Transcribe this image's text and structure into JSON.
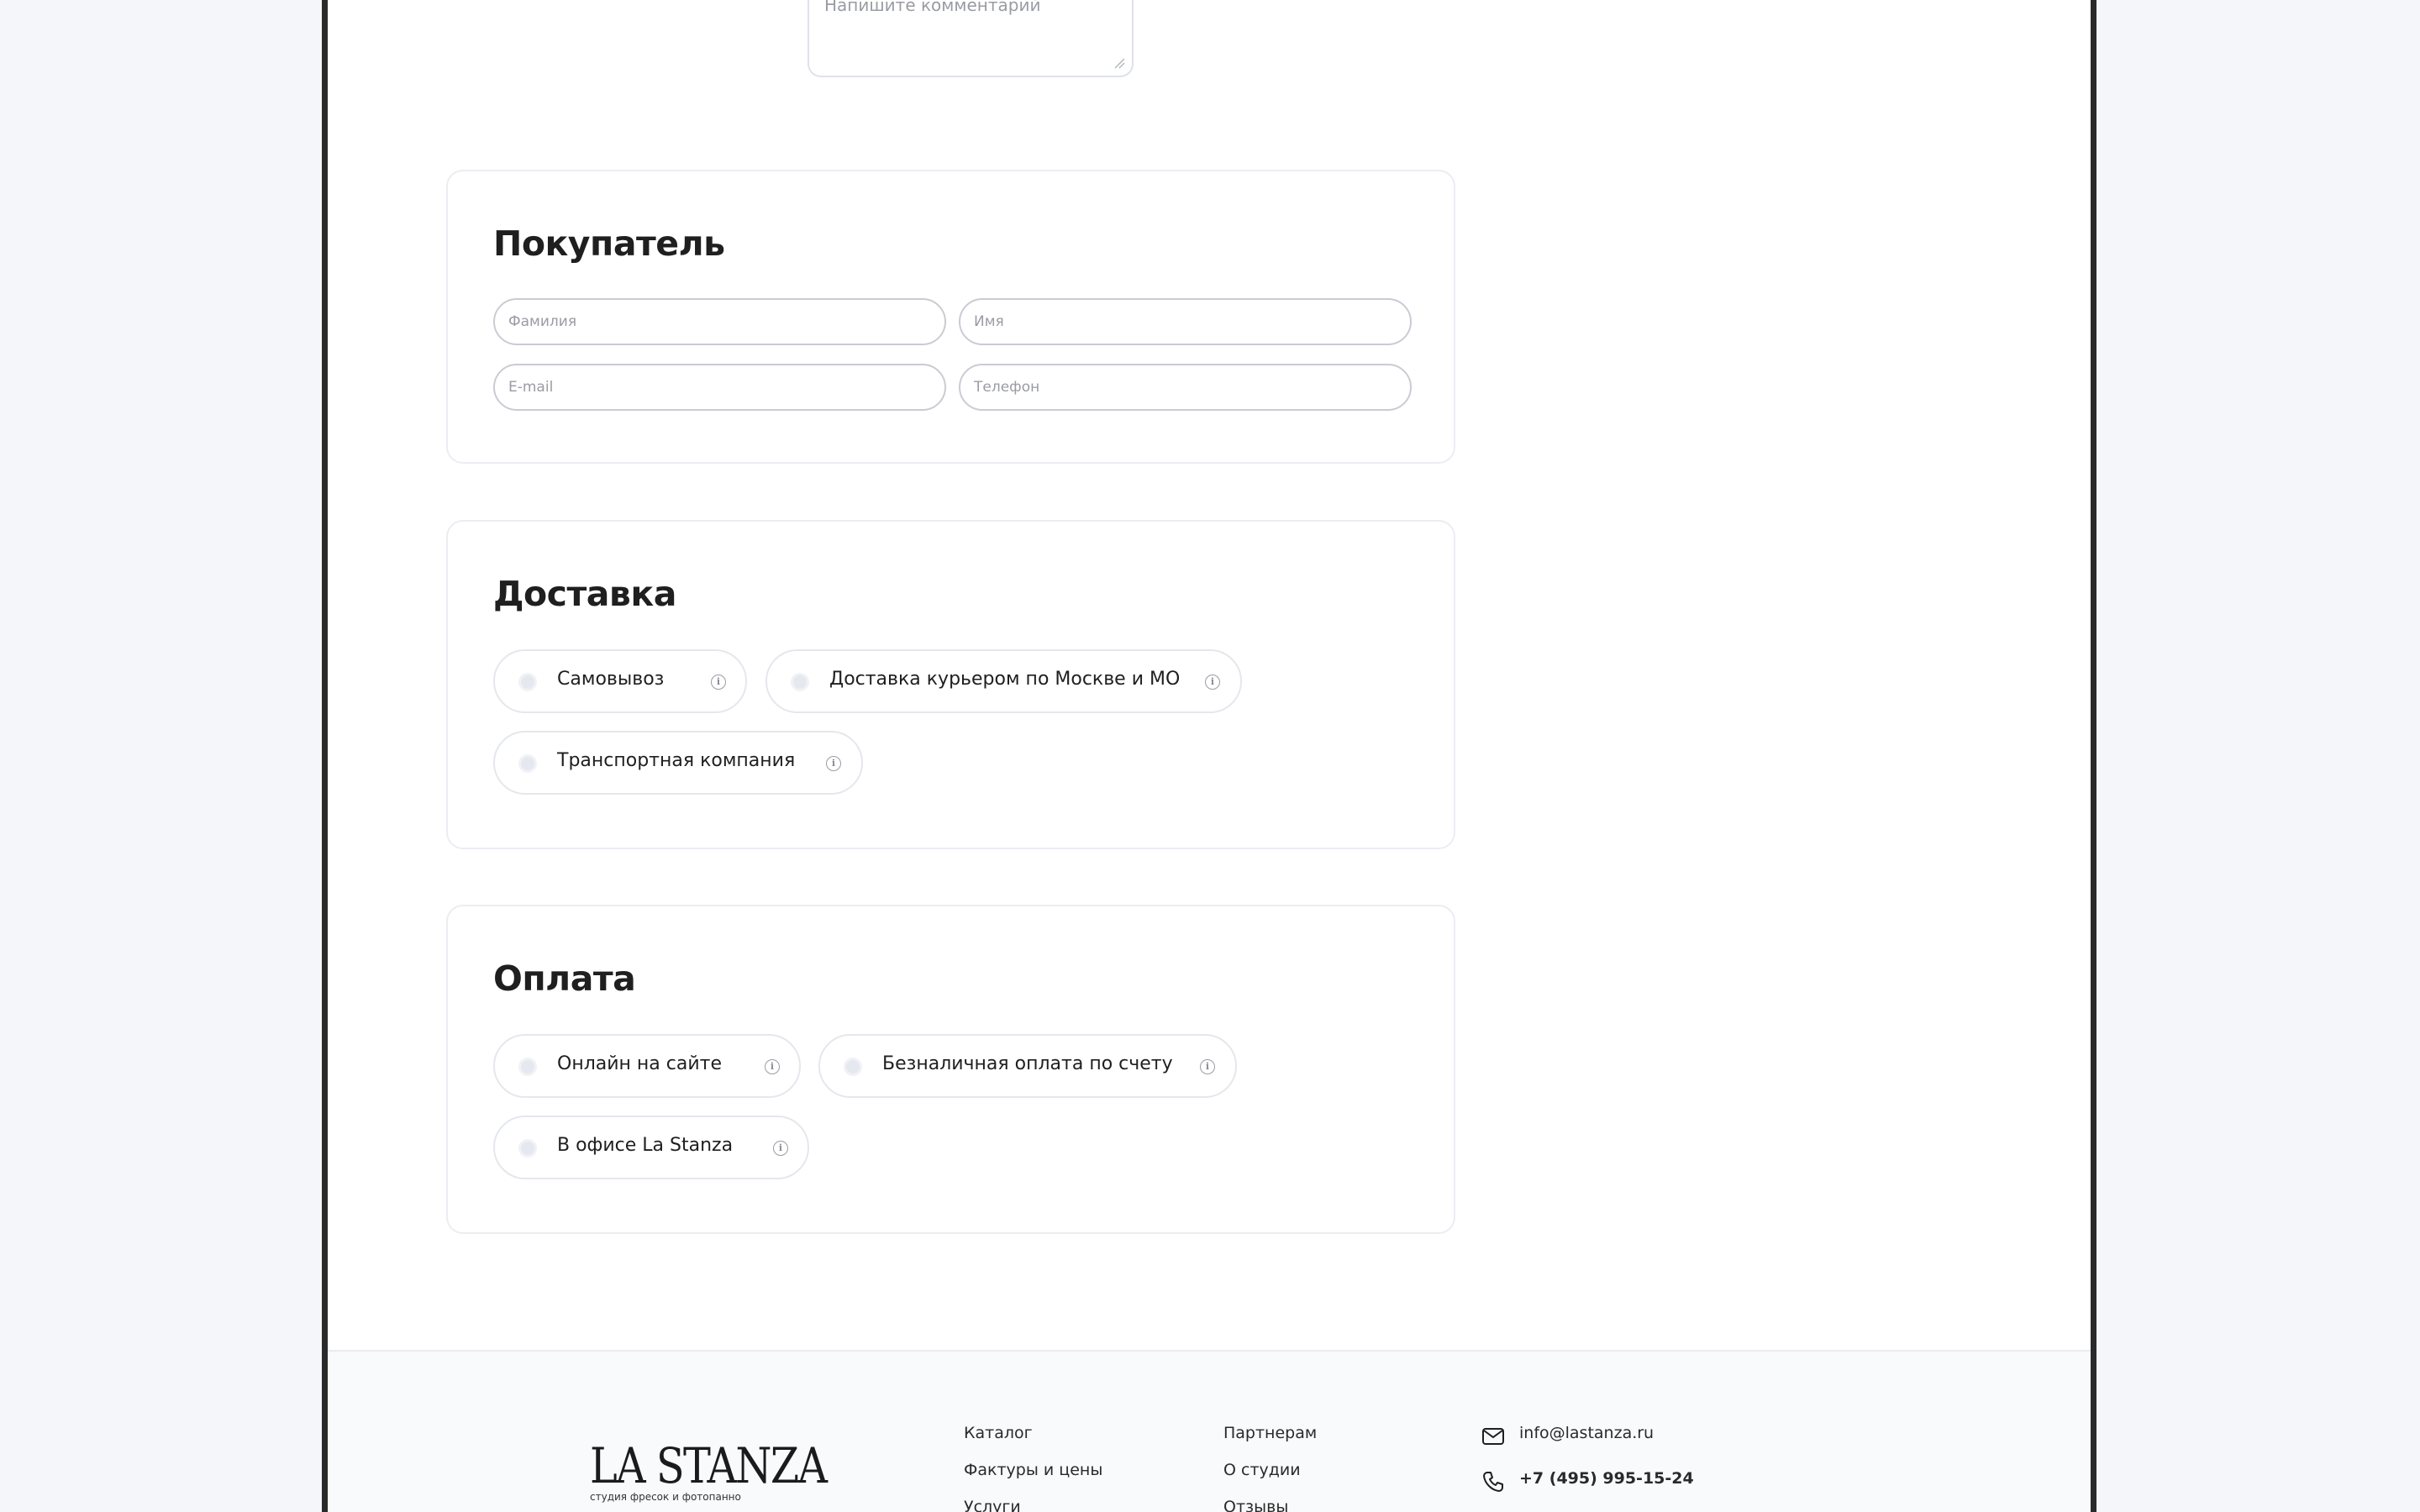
{
  "comment": {
    "placeholder": "Напишите комментарий"
  },
  "buyer": {
    "title": "Покупатель",
    "last_name_placeholder": "Фамилия",
    "first_name_placeholder": "Имя",
    "email_placeholder": "E-mail",
    "phone_placeholder": "Телефон"
  },
  "delivery": {
    "title": "Доставка",
    "options": [
      {
        "label": "Самовывоз"
      },
      {
        "label": "Доставка курьером по Москве и МО"
      },
      {
        "label": "Транспортная компания"
      }
    ]
  },
  "payment": {
    "title": "Оплата",
    "options": [
      {
        "label": "Онлайн на сайте"
      },
      {
        "label": "Безналичная оплата по счету"
      },
      {
        "label": "В офисе La Stanza"
      }
    ]
  },
  "footer": {
    "logo_text": "LA STANZA",
    "logo_tagline": "студия фресок и фотопанно",
    "col1": [
      "Каталог",
      "Фактуры и цены",
      "Услуги"
    ],
    "col2": [
      "Партнерам",
      "О студии",
      "Отзывы"
    ],
    "email": "info@lastanza.ru",
    "phone": "+7 (495) 995-15-24",
    "icons": {
      "email": "envelope-icon",
      "phone": "phone-icon"
    }
  },
  "colors": {
    "page_bg": "#f4f6fa",
    "frame_border": "#2a2a2a",
    "text": "#1f1f1f",
    "muted": "#9a9ca3"
  }
}
